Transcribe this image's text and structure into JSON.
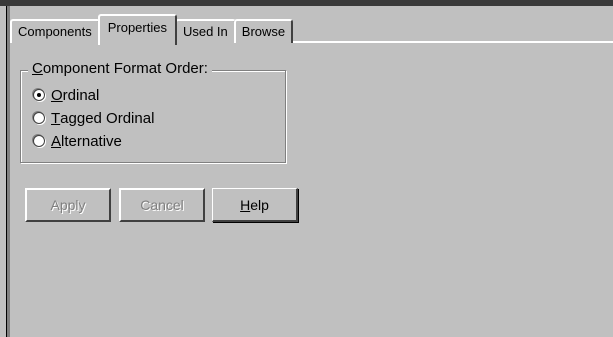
{
  "tabs": [
    {
      "label": "Components",
      "active": false
    },
    {
      "label": "Properties",
      "active": true
    },
    {
      "label": "Used In",
      "active": false
    },
    {
      "label": "Browse",
      "active": false
    }
  ],
  "group": {
    "legend_mnemonic": "C",
    "legend_rest": "omponent Format Order:",
    "options": [
      {
        "mnemonic": "O",
        "rest": "rdinal",
        "selected": true
      },
      {
        "mnemonic": "T",
        "rest": "agged Ordinal",
        "selected": false
      },
      {
        "mnemonic": "A",
        "rest": "lternative",
        "selected": false
      }
    ]
  },
  "buttons": {
    "apply_label": "Apply",
    "cancel_label": "Cancel",
    "help_mnemonic": "H",
    "help_rest": "elp"
  }
}
